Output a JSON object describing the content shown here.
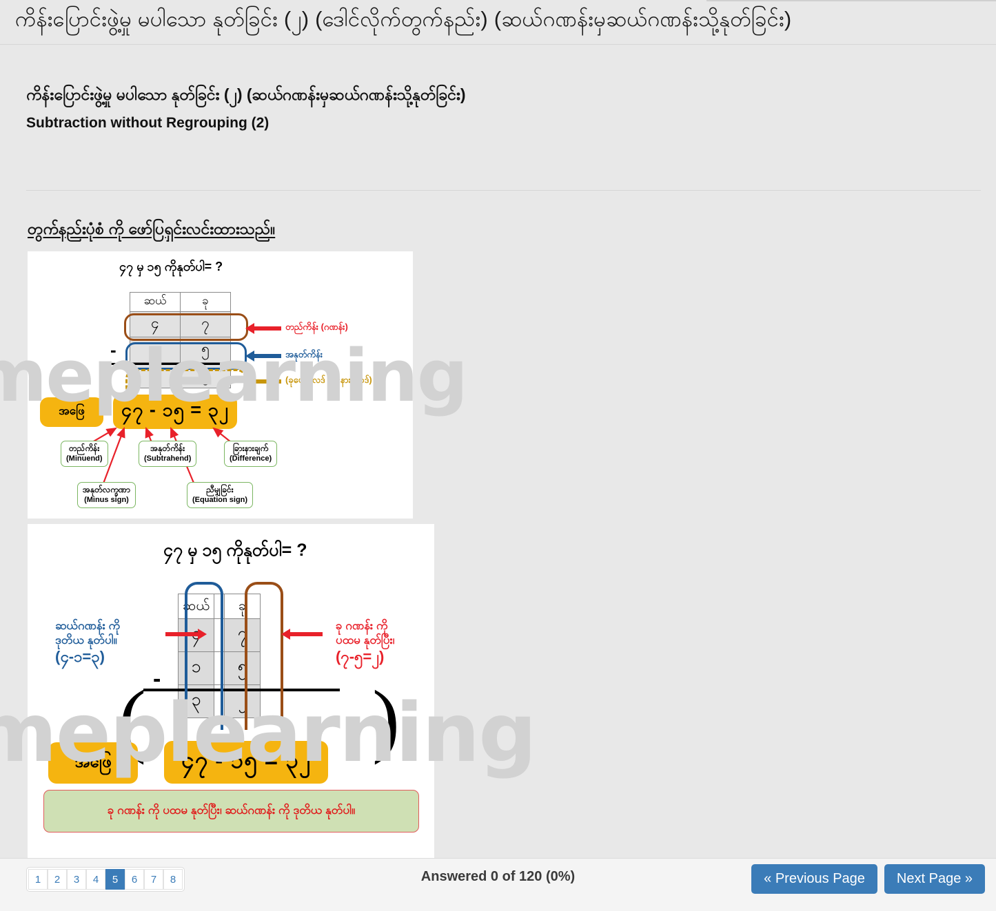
{
  "header": {
    "title": "ကိန်းပြောင်းဖွဲ့မှု မပါသော နုတ်ခြင်း (၂) (ဒေါင်လိုက်တွက်နည်း) (ဆယ်ဂဏန်းမှဆယ်ဂဏန်းသို့နုတ်ခြင်း)"
  },
  "question": {
    "my_title": "ကိန်းပြောင်းဖွဲ့မှု မပါသော နုတ်ခြင်း (၂) (ဆယ်ဂဏန်းမှဆယ်ဂဏန်းသို့နုတ်ခြင်း)",
    "en_title": "Subtraction without Regrouping (2)"
  },
  "instruction": "တွက်နည်းပုံစံ ကို ဖော်ပြရှင်းလင်းထားသည်။",
  "watermark": "meplearning",
  "figure1": {
    "title": "၄၇ မှ ၁၅ ကိုနုတ်ပါ= ?",
    "table": {
      "headers": [
        "ဆယ်",
        "ခု"
      ],
      "minuend_row": [
        "၄",
        "၇"
      ],
      "subtrahend_row": [
        "၁",
        "၅"
      ],
      "difference_row": [
        "၃",
        "၂"
      ]
    },
    "minus_sign": "-",
    "labels": {
      "minuend_arrow": "တည်ကိန်း (ဂဏန်း)",
      "subtrahend_arrow": "အနုတ်ကိန်း",
      "difference_arrow": "(ခုပေါင်းလဒ် ခြားနားရလဒ်)"
    },
    "answer_label": "အဖြေ",
    "answer_equation": "၄၇ - ၁၅ = ၃၂",
    "callouts": [
      {
        "my": "တည်ကိန်း",
        "en": "(Minuend)"
      },
      {
        "my": "အနုတ်ကိန်း",
        "en": "(Subtrahend)"
      },
      {
        "my": "ခြားနားချက်",
        "en": "(Difference)"
      },
      {
        "my": "အနုတ်လက္ခဏာ",
        "en": "(Minus sign)"
      },
      {
        "my": "ညီမျှခြင်း",
        "en": "(Equation sign)"
      }
    ]
  },
  "figure2": {
    "title": "၄၇ မှ ၁၅ ကိုနုတ်ပါ= ?",
    "table": {
      "headers": [
        "ဆယ်",
        "ခု"
      ],
      "minuend_row": [
        "၄",
        "၇"
      ],
      "subtrahend_row": [
        "၁",
        "၅"
      ],
      "difference_row": [
        "၃",
        "၂"
      ]
    },
    "minus_sign": "-",
    "note_left_line1": "ဆယ်ဂဏန်း ကို",
    "note_left_line2": "ဒုတိယ နုတ်ပါ။",
    "note_left_eqn": "(၄-၁=၃)",
    "note_right_line1": "ခု ဂဏန်း ကို",
    "note_right_line2": "ပထမ နုတ်ပြီး၊",
    "note_right_eqn": "(၇-၅=၂)",
    "answer_label": "အဖြေ",
    "answer_equation": "၄၇ - ၁၅ = ၃၂",
    "banner": "ခု ဂဏန်း ကို ပထမ နုတ်ပြီး၊ ဆယ်ဂဏန်း ကို ဒုတိယ နုတ်ပါ။"
  },
  "footer": {
    "pages": [
      "1",
      "2",
      "3",
      "4",
      "5",
      "6",
      "7",
      "8"
    ],
    "active_page": "5",
    "answered_status": "Answered 0 of 120 (0%)",
    "prev_label": "« Previous Page",
    "next_label": "Next Page »"
  },
  "colors": {
    "accent": "#3b7cb8",
    "pill": "#f5b410",
    "red": "#e8212a",
    "blue": "#1f5c99",
    "brown": "#9a4e17",
    "gold": "#c8960c",
    "green_banner": "#cfe0b4"
  }
}
